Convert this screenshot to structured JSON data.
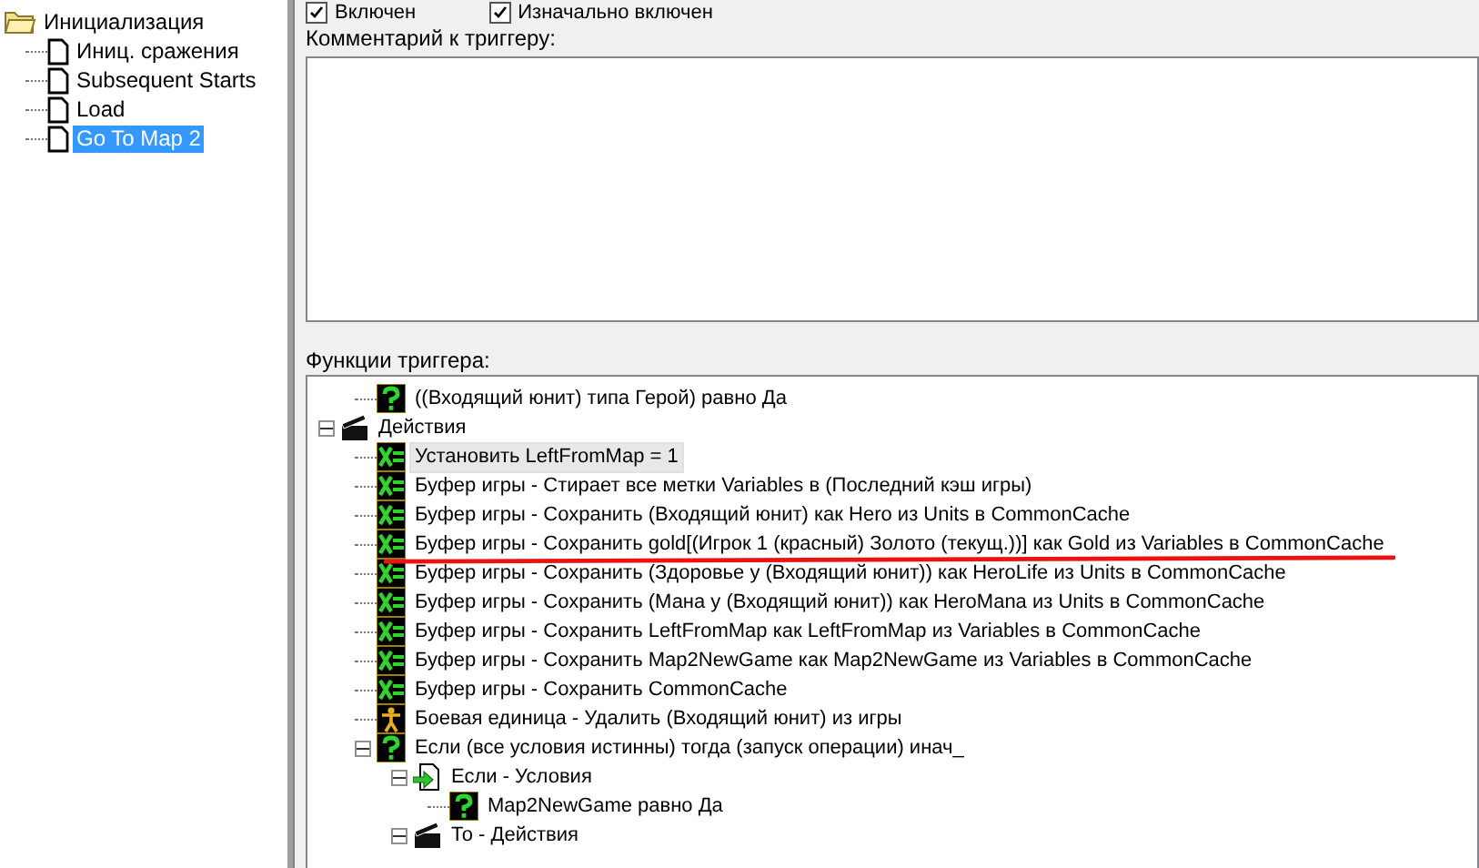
{
  "trigger_list": {
    "folder": {
      "label": "Инициализация",
      "expanded": true,
      "children": [
        {
          "label": "Иниц. сражения",
          "selected": false
        },
        {
          "label": "Subsequent Starts",
          "selected": false
        },
        {
          "label": "Load",
          "selected": false
        },
        {
          "label": "Go To Map 2",
          "selected": true
        }
      ]
    }
  },
  "options": [
    {
      "label": "Включен",
      "checked": true
    },
    {
      "label": "Изначально включен",
      "checked": true
    }
  ],
  "comment": {
    "label": "Комментарий к триггеру:"
  },
  "functions": {
    "label": "Функции триггера:",
    "condition_tail": [
      {
        "kind": "condition",
        "text": "((Входящий юнит) типа Герой) равно Да"
      }
    ],
    "tree": [
      {
        "kind": "actions",
        "text": "Действия",
        "expanded": true,
        "children": [
          {
            "kind": "action",
            "text": "Установить LeftFromMap = 1",
            "selected": true
          },
          {
            "kind": "action",
            "text": "Буфер игры - Стирает все метки Variables в (Последний кэш игры)",
            "selected": false
          },
          {
            "kind": "action",
            "text": "Буфер игры - Сохранить (Входящий юнит) как Hero из Units в CommonCache",
            "selected": false
          },
          {
            "kind": "action",
            "text": "Буфер игры - Сохранить gold[(Игрок 1 (красный) Золото (текущ.))] как Gold из Variables в CommonCache",
            "selected": false
          },
          {
            "kind": "action",
            "text": "Буфер игры - Сохранить (Здоровье у (Входящий юнит)) как HeroLife из Units в CommonCache",
            "selected": false
          },
          {
            "kind": "action",
            "text": "Буфер игры - Сохранить (Мана у (Входящий юнит)) как HeroMana из Units в CommonCache",
            "selected": false
          },
          {
            "kind": "action",
            "text": "Буфер игры - Сохранить LeftFromMap как LeftFromMap из Variables в CommonCache",
            "selected": false
          },
          {
            "kind": "action",
            "text": "Буфер игры - Сохранить Map2NewGame как Map2NewGame из Variables в CommonCache",
            "selected": false
          },
          {
            "kind": "action",
            "text": "Буфер игры - Сохранить CommonCache",
            "selected": false
          },
          {
            "kind": "unit",
            "text": "Боевая единица - Удалить (Входящий юнит) из игры",
            "selected": false
          },
          {
            "kind": "condition",
            "text": "Если (все условия истинны) тогда (запуск операции) инач_",
            "expanded": true,
            "children": [
              {
                "kind": "if",
                "text": "Если - Условия",
                "expanded": true,
                "children": [
                  {
                    "kind": "condition",
                    "text": "Map2NewGame равно Да",
                    "selected": false
                  }
                ]
              },
              {
                "kind": "actions",
                "text": "То - Действия",
                "expanded": true
              }
            ]
          }
        ]
      }
    ]
  }
}
